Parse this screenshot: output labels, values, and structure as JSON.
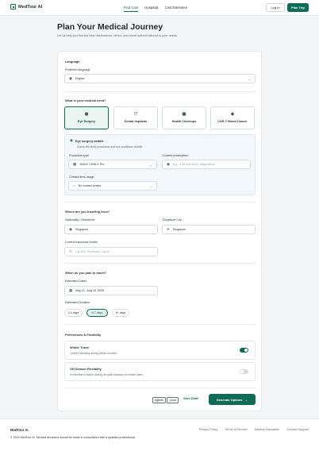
{
  "nav": {
    "brand": "MedTour AI",
    "links": [
      "Find Care",
      "Hospitals",
      "Cost Estimates"
    ],
    "login": "Log In",
    "plan_trip": "Plan Trip"
  },
  "header": {
    "title": "Plan Your Medical Journey",
    "subtitle": "Let us help you find the best destinations, clinics, and travel options tailored to your needs."
  },
  "language": {
    "section": "Language",
    "label": "Preferred language",
    "value": "English"
  },
  "need": {
    "section": "What is your medical need?",
    "options": [
      "Eye Surgery",
      "Dental Implants",
      "Health Checkups",
      "CAR-T Blood Cancer"
    ],
    "selected": "Eye Surgery"
  },
  "eye": {
    "title": "Eye surgery details",
    "desc": "Clarify the likely procedure and eye-readiness details.",
    "procedure_label": "Procedure type",
    "procedure_value": "SMILE / SMILE Pro",
    "prescription_label": "Current prescription",
    "prescription_placeholder": "e.g. -4.50 both eyes, astigmatism",
    "lens_label": "Contact lens usage",
    "lens_value": "No contact lenses"
  },
  "origin": {
    "section": "Where are you traveling from?",
    "nationality_label": "Nationality / Residence",
    "nationality_value": "Singapore",
    "departure_label": "Departure City",
    "departure_value": "Singapore",
    "insurance_label": "Current Insurance Holder",
    "insurance_placeholder": "e.g. AIA, Prudential, Cigna"
  },
  "travel": {
    "section": "When do you plan to travel?",
    "dates_label": "Estimated Dates",
    "dates_value": "Aug 12 - Aug 16, 2026",
    "duration_label": "Estimated Duration",
    "durations": [
      "3-4 days",
      "5-7 days",
      "8+ days"
    ],
    "selected_duration": "5-7 days"
  },
  "prefs": {
    "section": "Preferences & Flexibility",
    "winter_title": "Winter Travel",
    "winter_desc": "I prefer traveling during winter months.",
    "winter_on": true,
    "offseason_title": "Off-Season Flexibility",
    "offseason_desc": "I'm flexible to travel during off-peak seasons for better rates.",
    "offseason_on": false
  },
  "actions": {
    "agents": "Agents",
    "local": "Local",
    "save_draft": "Save Draft",
    "generate": "Generate Options"
  },
  "footer": {
    "brand": "MedTour AI",
    "links": [
      "Privacy Policy",
      "Terms of Service",
      "Medical Disclaimer",
      "Contact Support"
    ],
    "copyright": "© 2024 MedTour AI. Medical decisions should be made in consultation with a qualified professional."
  },
  "colors": {
    "accent": "#0f6b55",
    "background": "#f3f5f7"
  }
}
